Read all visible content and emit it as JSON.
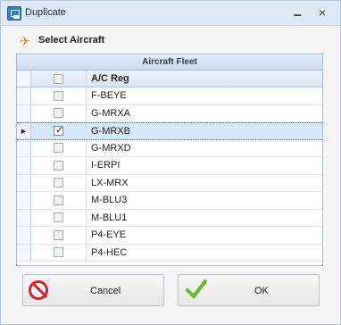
{
  "window": {
    "title": "Duplicate",
    "close_symbol": "×",
    "icons": {
      "app": "app-window-icon",
      "minimize": "minimize-icon",
      "close": "close-icon"
    }
  },
  "section": {
    "title": "Select Aircraft",
    "icon": "airplane-icon"
  },
  "grid": {
    "group_header": "Aircraft Fleet",
    "column_header": "A/C Reg",
    "rows": [
      {
        "reg": "F-BEYE",
        "checked": false,
        "selected": false
      },
      {
        "reg": "G-MRXA",
        "checked": false,
        "selected": false
      },
      {
        "reg": "G-MRXB",
        "checked": true,
        "selected": true
      },
      {
        "reg": "G-MRXD",
        "checked": false,
        "selected": false
      },
      {
        "reg": "I-ERPI",
        "checked": false,
        "selected": false
      },
      {
        "reg": "LX-MRX",
        "checked": false,
        "selected": false
      },
      {
        "reg": "M-BLU3",
        "checked": false,
        "selected": false
      },
      {
        "reg": "M-BLU1",
        "checked": false,
        "selected": false
      },
      {
        "reg": "P4-EYE",
        "checked": false,
        "selected": false
      },
      {
        "reg": "P4-HEC",
        "checked": false,
        "selected": false
      }
    ]
  },
  "buttons": {
    "cancel": {
      "label": "Cancel",
      "icon": "no-entry-icon"
    },
    "ok": {
      "label": "OK",
      "icon": "checkmark-icon"
    }
  },
  "colors": {
    "accent_orange": "#f08a24",
    "cancel_red": "#d6222a",
    "ok_green": "#6bb82d",
    "selection_blue": "#d8e9fb"
  }
}
